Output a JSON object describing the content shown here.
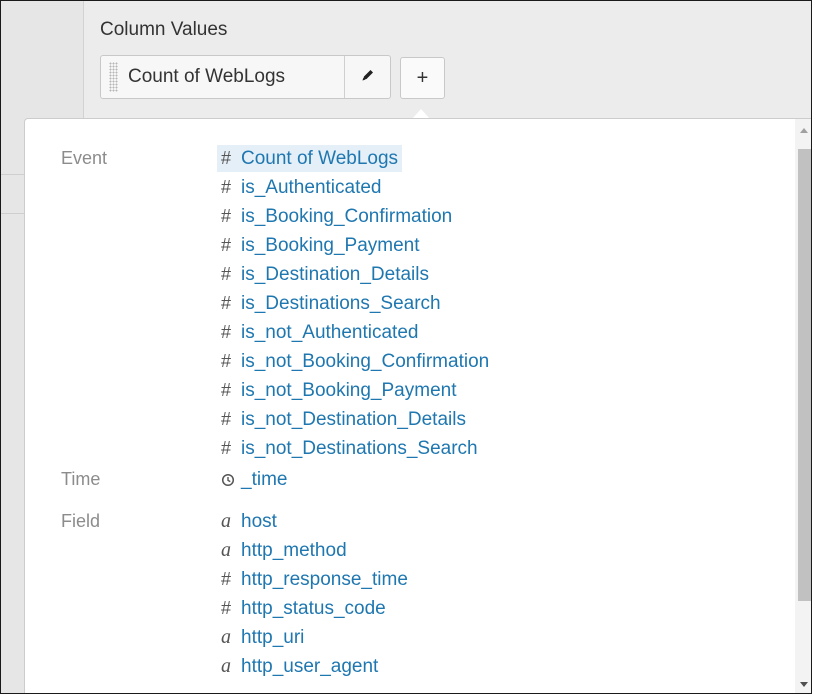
{
  "column_values": {
    "label": "Column Values",
    "pill_label": "Count of WebLogs",
    "add_label": "+"
  },
  "popup": {
    "groups": [
      {
        "label": "Event",
        "items": [
          {
            "type": "#",
            "label": "Count of WebLogs",
            "selected": true
          },
          {
            "type": "#",
            "label": "is_Authenticated"
          },
          {
            "type": "#",
            "label": "is_Booking_Confirmation"
          },
          {
            "type": "#",
            "label": "is_Booking_Payment"
          },
          {
            "type": "#",
            "label": "is_Destination_Details"
          },
          {
            "type": "#",
            "label": "is_Destinations_Search"
          },
          {
            "type": "#",
            "label": "is_not_Authenticated"
          },
          {
            "type": "#",
            "label": "is_not_Booking_Confirmation"
          },
          {
            "type": "#",
            "label": "is_not_Booking_Payment"
          },
          {
            "type": "#",
            "label": "is_not_Destination_Details"
          },
          {
            "type": "#",
            "label": "is_not_Destinations_Search"
          }
        ]
      },
      {
        "label": "Time",
        "items": [
          {
            "type": "clock-icon",
            "label": "_time"
          }
        ]
      },
      {
        "label": "Field",
        "items": [
          {
            "type": "a",
            "label": "host"
          },
          {
            "type": "a",
            "label": "http_method"
          },
          {
            "type": "#",
            "label": "http_response_time"
          },
          {
            "type": "#",
            "label": "http_status_code"
          },
          {
            "type": "a",
            "label": "http_uri"
          },
          {
            "type": "a",
            "label": "http_user_agent"
          }
        ]
      }
    ]
  },
  "colors": {
    "link": "#1f77b0",
    "selected_bg": "#e4eff8",
    "group_label": "#8c8c8c"
  }
}
